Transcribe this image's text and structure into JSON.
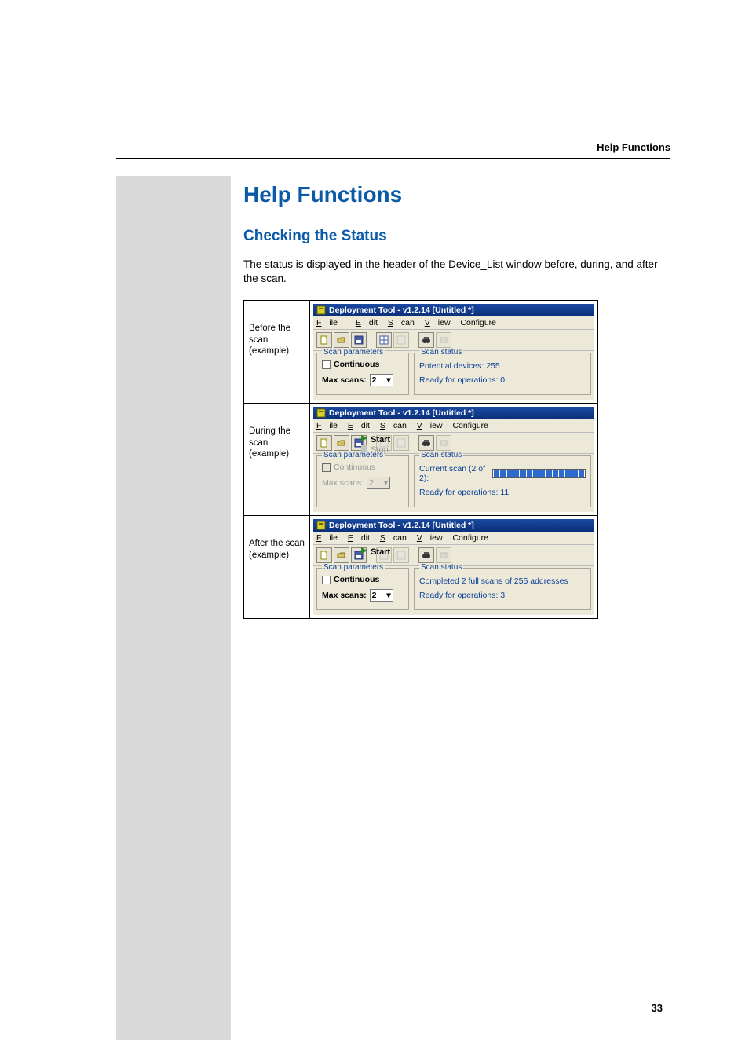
{
  "header": {
    "section": "Help Functions"
  },
  "headings": {
    "h1": "Help Functions",
    "h2": "Checking the Status"
  },
  "body_text": "The status is displayed in the header of the Device_List window before, during, and after the scan.",
  "page_number": "33",
  "rows": {
    "before": {
      "label": "Before the scan (example)"
    },
    "during": {
      "label": "During the scan (example)"
    },
    "after": {
      "label": "After the scan (example)"
    }
  },
  "app": {
    "title": "Deployment Tool - v1.2.14  [Untitled *]",
    "menu": {
      "file": "File",
      "edit": "Edit",
      "scan": "Scan",
      "view": "View",
      "configure": "Configure"
    },
    "scan_menu": {
      "start": "Start",
      "stop": "Stop"
    },
    "group": {
      "params": "Scan parameters",
      "status": "Scan status"
    },
    "params": {
      "continuous": "Continuous",
      "max_scans_label": "Max scans:",
      "max_scans_value": "2"
    },
    "status": {
      "before_line1": "Potential devices: 255",
      "before_line2": "Ready for operations: 0",
      "during_line1": "Current scan (2 of 2):",
      "during_line2": "Ready for operations: 11",
      "after_line1": "Completed 2 full scans of 255 addresses",
      "after_line2": "Ready for operations: 3"
    }
  }
}
